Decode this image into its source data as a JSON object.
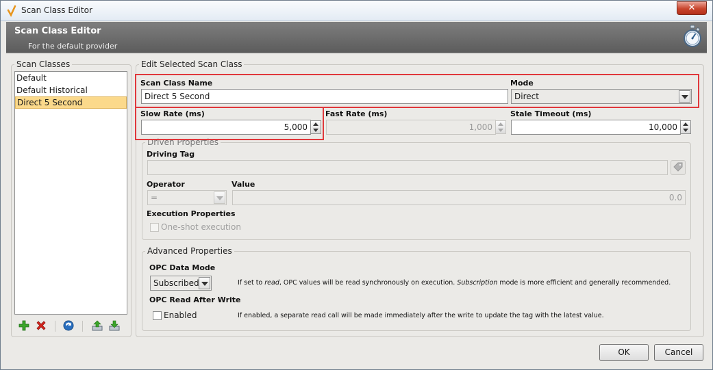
{
  "window": {
    "title": "Scan Class Editor",
    "close_label": "✕"
  },
  "header": {
    "title": "Scan Class Editor",
    "subtitle": "For the default provider"
  },
  "scan_classes": {
    "legend": "Scan Classes",
    "items": [
      "Default",
      "Default Historical",
      "Direct 5 Second"
    ],
    "selected_index": 2
  },
  "edit": {
    "legend": "Edit Selected Scan Class",
    "scan_class_name_label": "Scan Class Name",
    "scan_class_name_value": "Direct 5 Second",
    "mode_label": "Mode",
    "mode_value": "Direct",
    "slow_rate_label": "Slow Rate (ms)",
    "slow_rate_value": "5,000",
    "fast_rate_label": "Fast Rate (ms)",
    "fast_rate_value": "1,000",
    "stale_timeout_label": "Stale Timeout (ms)",
    "stale_timeout_value": "10,000"
  },
  "driven": {
    "legend": "Driven Properties",
    "driving_tag_label": "Driving Tag",
    "driving_tag_value": "",
    "operator_label": "Operator",
    "operator_value": "=",
    "value_label": "Value",
    "value_value": "0.0",
    "execution_label": "Execution Properties",
    "one_shot_label": "One-shot execution"
  },
  "advanced": {
    "legend": "Advanced Properties",
    "opc_data_mode_label": "OPC Data Mode",
    "opc_data_mode_value": "Subscribed",
    "opc_data_mode_hint_1": "If set to ",
    "opc_data_mode_hint_read": "read",
    "opc_data_mode_hint_2": ", OPC values will be read synchronously on execution. ",
    "opc_data_mode_hint_sub": "Subscription",
    "opc_data_mode_hint_3": " mode is more efficient and generally recommended.",
    "opc_read_after_write_label": "OPC Read After Write",
    "enabled_label": "Enabled",
    "enabled_checked": false,
    "read_after_write_hint": "If enabled, a separate read call will be made immediately after the write to update the tag with the latest value."
  },
  "buttons": {
    "ok": "OK",
    "cancel": "Cancel"
  },
  "colors": {
    "highlight": "#e0383c",
    "selected_item": "#fbd98b",
    "header_bg": "#6b6b6b"
  }
}
